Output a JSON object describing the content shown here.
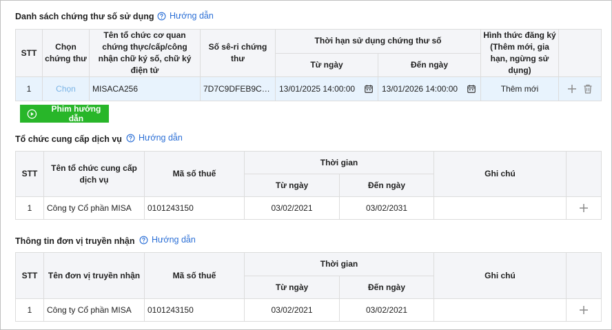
{
  "section1": {
    "title": "Danh sách chứng thư số sử dụng",
    "help": "Hướng dẫn",
    "headers": {
      "stt": "STT",
      "choose": "Chọn chứng thư",
      "org": "Tên tổ chức cơ quan chứng thực/cấp/công nhận chữ ký số, chữ ký điện tử",
      "serial": "Số sê-ri chứng thư",
      "period": "Thời hạn sử dụng chứng thư số",
      "from": "Từ ngày",
      "to": "Đến ngày",
      "reg": "Hình thức đăng ký (Thêm mới, gia hạn, ngừng sử dụng)"
    },
    "rows": [
      {
        "stt": "1",
        "choose": "Chọn",
        "org": "MISACA256",
        "serial": "7D7C9DFEB9CB...",
        "from": "13/01/2025 14:00:00",
        "to": "13/01/2026 14:00:00",
        "reg": "Thêm mới"
      }
    ],
    "video_button": "Phim hướng dẫn"
  },
  "section2": {
    "title": "Tổ chức cung cấp dịch vụ",
    "help": "Hướng dẫn",
    "headers": {
      "stt": "STT",
      "name": "Tên tổ chức cung cấp dịch vụ",
      "tax": "Mã số thuế",
      "time": "Thời gian",
      "from": "Từ ngày",
      "to": "Đến ngày",
      "note": "Ghi chú"
    },
    "rows": [
      {
        "stt": "1",
        "name": "Công ty Cổ phần MISA",
        "tax": "0101243150",
        "from": "03/02/2021",
        "to": "03/02/2031",
        "note": ""
      }
    ]
  },
  "section3": {
    "title": "Thông tin đơn vị truyền nhận",
    "help": "Hướng dẫn",
    "headers": {
      "stt": "STT",
      "name": "Tên đơn vị truyền nhận",
      "tax": "Mã số thuế",
      "time": "Thời gian",
      "from": "Từ ngày",
      "to": "Đến ngày",
      "note": "Ghi chú"
    },
    "rows": [
      {
        "stt": "1",
        "name": "Công ty Cổ phần MISA",
        "tax": "0101243150",
        "from": "03/02/2021",
        "to": "03/02/2021",
        "note": ""
      }
    ]
  },
  "icons": {
    "help": "question-circle-icon",
    "calendar": "calendar-icon",
    "add": "plus-icon",
    "delete": "trash-icon",
    "video": "play-circle-icon"
  },
  "colors": {
    "link": "#2b6fd6",
    "header_bg": "#f4f5f8",
    "selected_row": "#e8f3fd",
    "video_button": "#28b629"
  }
}
